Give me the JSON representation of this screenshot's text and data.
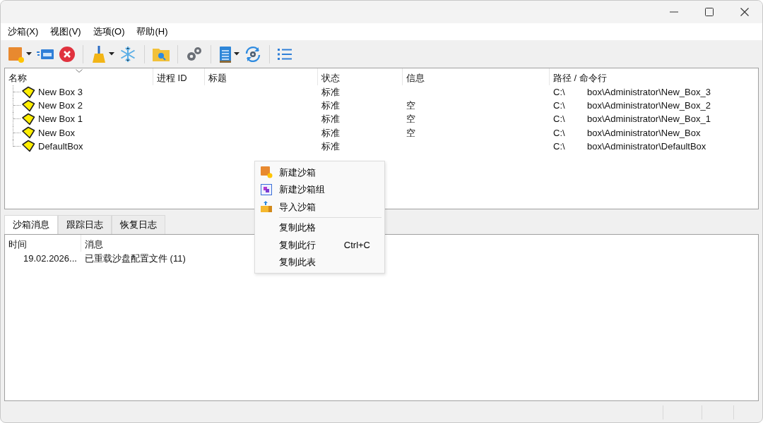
{
  "menu": [
    "沙箱(X)",
    "视图(V)",
    "选项(O)",
    "帮助(H)"
  ],
  "toolbar": [
    {
      "kind": "new-box",
      "dropdown": true
    },
    {
      "kind": "window",
      "dropdown": false
    },
    {
      "kind": "terminate",
      "dropdown": false
    },
    {
      "kind": "separator"
    },
    {
      "kind": "broom",
      "dropdown": true
    },
    {
      "kind": "snowflake",
      "dropdown": false
    },
    {
      "kind": "separator"
    },
    {
      "kind": "folder-search",
      "dropdown": false
    },
    {
      "kind": "separator"
    },
    {
      "kind": "gears",
      "dropdown": false
    },
    {
      "kind": "separator"
    },
    {
      "kind": "notepad",
      "dropdown": true
    },
    {
      "kind": "refresh",
      "dropdown": false
    },
    {
      "kind": "separator"
    },
    {
      "kind": "list",
      "dropdown": false
    }
  ],
  "tree": {
    "columns": [
      "名称",
      "进程 ID",
      "标题",
      "状态",
      "信息",
      "路径 / 命令行"
    ],
    "rows": [
      {
        "name": "New Box 3",
        "status": "标准",
        "path_drive": "C:\\",
        "path": "box\\Administrator\\New_Box_3"
      },
      {
        "name": "New Box 2",
        "status": "标准",
        "info": "空",
        "path_drive": "C:\\",
        "path": "box\\Administrator\\New_Box_2"
      },
      {
        "name": "New Box 1",
        "status": "标准",
        "info": "空",
        "path_drive": "C:\\",
        "path": "box\\Administrator\\New_Box_1"
      },
      {
        "name": "New Box",
        "status": "标准",
        "info": "空",
        "path_drive": "C:\\",
        "path": "box\\Administrator\\New_Box"
      },
      {
        "name": "DefaultBox",
        "status": "标准",
        "path_drive": "C:\\",
        "path": "box\\Administrator\\DefaultBox"
      }
    ]
  },
  "tabs": [
    {
      "label": "沙箱消息",
      "selected": true
    },
    {
      "label": "跟踪日志",
      "selected": false
    },
    {
      "label": "恢复日志",
      "selected": false
    }
  ],
  "log": {
    "columns": [
      "时间",
      "消息"
    ],
    "rows": [
      {
        "time": "19.02.2026...",
        "message": "已重载沙盘配置文件 (11)"
      }
    ]
  },
  "context_menu": [
    {
      "kind": "new-box",
      "label": "新建沙箱"
    },
    {
      "kind": "new-group",
      "label": "新建沙箱组"
    },
    {
      "kind": "import",
      "label": "导入沙箱"
    },
    {
      "kind": "separator"
    },
    {
      "kind": "item",
      "label": "复制此格"
    },
    {
      "kind": "item",
      "label": "复制此行",
      "shortcut": "Ctrl+C"
    },
    {
      "kind": "item",
      "label": "复制此表"
    }
  ]
}
